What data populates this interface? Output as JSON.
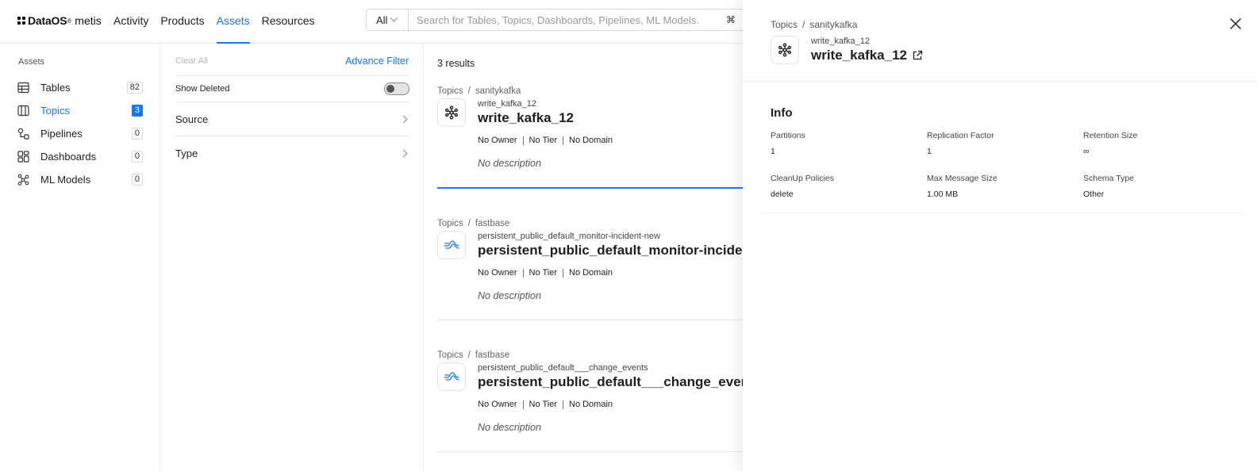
{
  "nav": {
    "brand": "DataOS",
    "reg": "®",
    "product": "metis",
    "links": [
      "Activity",
      "Products",
      "Assets",
      "Resources"
    ],
    "active_link": "Assets"
  },
  "search": {
    "scope": "All",
    "placeholder": "Search for Tables, Topics, Dashboards, Pipelines, ML Models.",
    "shortcut": "⌘"
  },
  "sidebar": {
    "title": "Assets",
    "items": [
      {
        "label": "Tables",
        "count": "82",
        "icon": "table-icon"
      },
      {
        "label": "Topics",
        "count": "3",
        "icon": "topic-icon",
        "active": true
      },
      {
        "label": "Pipelines",
        "count": "0",
        "icon": "pipeline-icon"
      },
      {
        "label": "Dashboards",
        "count": "0",
        "icon": "dashboard-icon"
      },
      {
        "label": "ML Models",
        "count": "0",
        "icon": "ml-model-icon"
      }
    ]
  },
  "filters": {
    "clear_all": "Clear All",
    "advance_filter": "Advance Filter",
    "show_deleted": "Show Deleted",
    "show_deleted_on": false,
    "sections": [
      "Source",
      "Type"
    ]
  },
  "results": {
    "count_label": "3 results",
    "items": [
      {
        "category": "Topics",
        "service": "sanitykafka",
        "sub": "write_kafka_12",
        "name": "write_kafka_12",
        "owner": "No Owner",
        "tier": "No Tier",
        "domain": "No Domain",
        "description": "No description",
        "icon": "kafka-icon"
      },
      {
        "category": "Topics",
        "service": "fastbase",
        "sub": "persistent_public_default_monitor-incident-new",
        "name": "persistent_public_default_monitor-incident-new",
        "owner": "No Owner",
        "tier": "No Tier",
        "domain": "No Domain",
        "description": "No description",
        "icon": "pulsar-icon"
      },
      {
        "category": "Topics",
        "service": "fastbase",
        "sub": "persistent_public_default___change_events",
        "name": "persistent_public_default___change_events",
        "owner": "No Owner",
        "tier": "No Tier",
        "domain": "No Domain",
        "description": "No description",
        "icon": "pulsar-icon"
      }
    ]
  },
  "drawer": {
    "category": "Topics",
    "service": "sanitykafka",
    "sub": "write_kafka_12",
    "name": "write_kafka_12",
    "info_title": "Info",
    "fields": [
      {
        "label": "Partitions",
        "value": "1"
      },
      {
        "label": "Replication Factor",
        "value": "1"
      },
      {
        "label": "Retention Size",
        "value": "∞"
      },
      {
        "label": "CleanUp Policies",
        "value": "delete"
      },
      {
        "label": "Max Message Size",
        "value": "1.00 MB"
      },
      {
        "label": "Schema Type",
        "value": "Other"
      }
    ]
  },
  "colors": {
    "accent": "#1677ff",
    "text": "#1f1f1f",
    "muted": "#555555",
    "border": "#e8e8e8"
  }
}
